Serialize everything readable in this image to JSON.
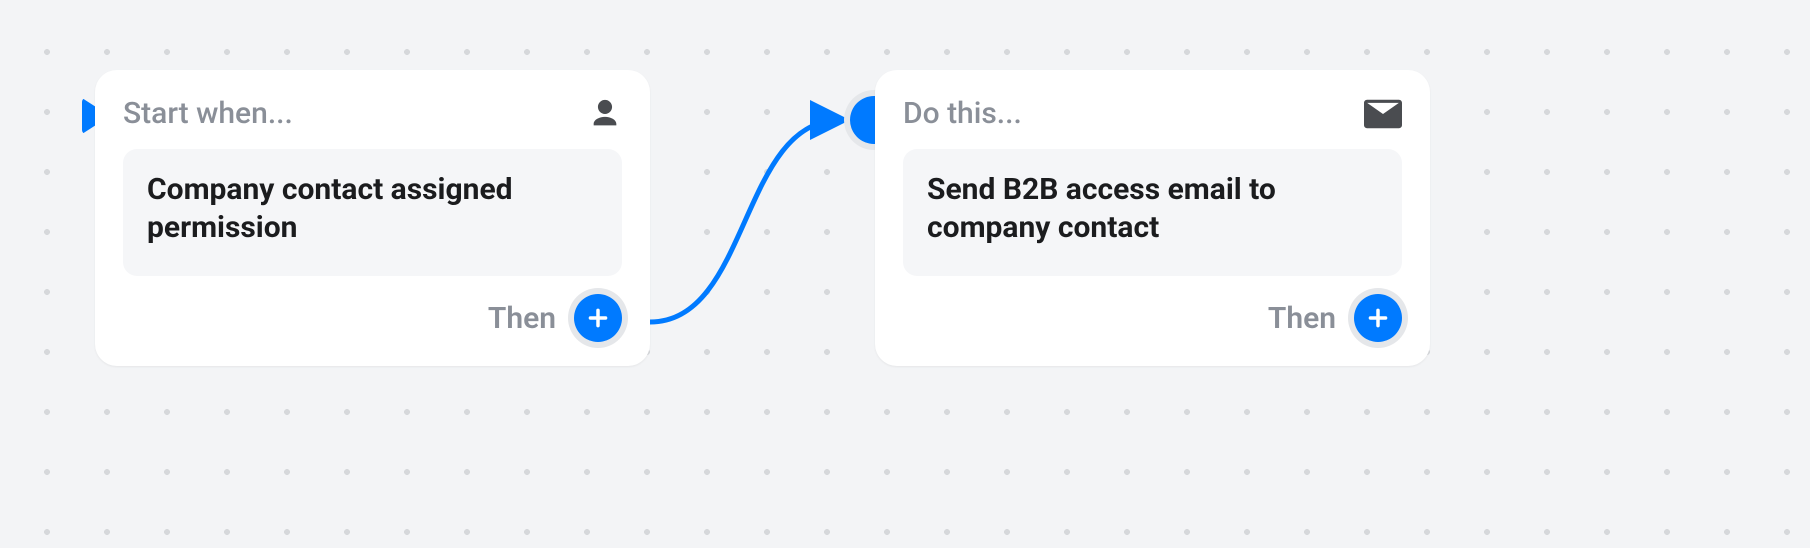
{
  "trigger": {
    "header": "Start when...",
    "body": "Company contact assigned permission",
    "footer": "Then",
    "icon": "person-icon"
  },
  "action": {
    "header": "Do this...",
    "body": "Send B2B access email to company contact",
    "footer": "Then",
    "icon": "mail-icon"
  },
  "colors": {
    "accent": "#007aff",
    "muted": "#8a8f98",
    "iconDark": "#4a4c50"
  }
}
